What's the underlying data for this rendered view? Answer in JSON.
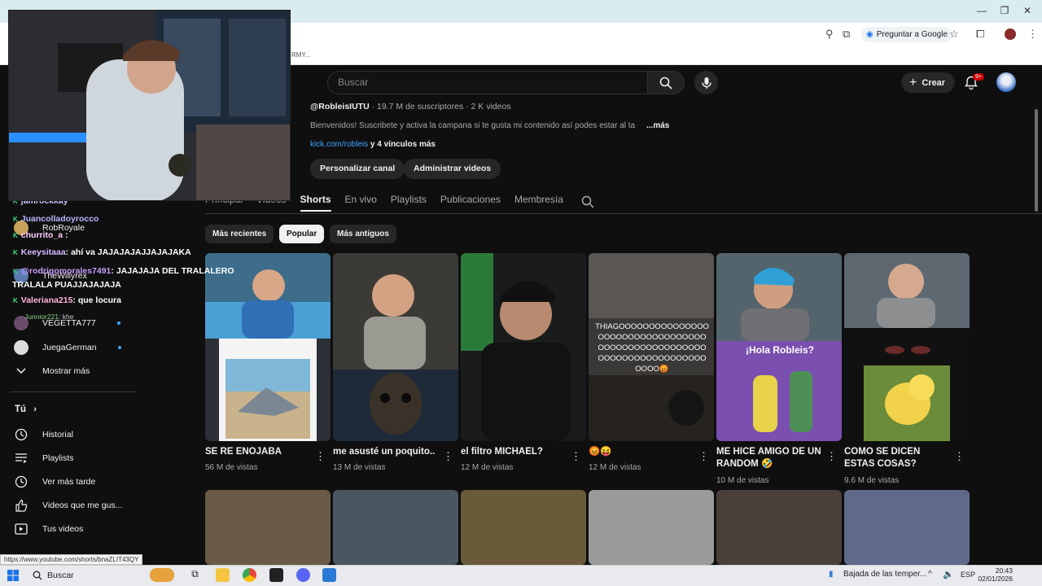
{
  "browser": {
    "ask_google": "Preguntar a Google",
    "bookmark_text": "RMY..."
  },
  "header": {
    "search_placeholder": "Buscar",
    "create_label": "Crear",
    "notification_count": "9+"
  },
  "channel": {
    "handle": "@RobleisIUTU",
    "stats": " · 19.7 M de suscriptores · 2 K videos",
    "description": "Bienvenidos! Suscribete y activa la campana si te gusta mi contenido así podes estar al ta",
    "more": "...más",
    "link": "kick.com/robleis",
    "links_more": " y 4 vínculos más",
    "btn_customize": "Personalizar canal",
    "btn_manage": "Administrar videos"
  },
  "tabs": [
    "Principal",
    "Videos",
    "Shorts",
    "En vivo",
    "Playlists",
    "Publicaciones",
    "Membresía"
  ],
  "chips": [
    "Más recientes",
    "Popular",
    "Más antiguos"
  ],
  "shorts": [
    {
      "title": "SE RE ENOJABA",
      "views": "56 M de vistas"
    },
    {
      "title": "me asusté un poquito..",
      "views": "13 M de vistas"
    },
    {
      "title": "el filtro MICHAEL?",
      "views": "12 M de vistas"
    },
    {
      "title": "😡😝",
      "views": "12 M de vistas"
    },
    {
      "title": "ME HICE AMIGO DE UN RANDOM 🤣",
      "views": "10 M de vistas"
    },
    {
      "title": "COMO SE DICEN ESTAS COSAS?",
      "views": "9.6 M de vistas"
    }
  ],
  "thumb_overlays": {
    "thiago": "THIAGOOOOOOOOOOOOOOOOOOOOOOOOOOOOOOOOOOOOOOOOOOOOOOOOOOOOOOOOOOOOOOOOOOOOOOOOO😡",
    "hola": "¡Hola Robleis?"
  },
  "sidebar": {
    "subs": [
      {
        "label": "RobRoyale"
      },
      {
        "label": "TheWillyrex"
      },
      {
        "label": "VEGETTA777"
      },
      {
        "label": "JuegaGerman"
      }
    ],
    "show_more": "Mostrar más",
    "you_section": "Tú",
    "you_items": [
      "Historial",
      "Playlists",
      "Ver más tarde",
      "Videos que me gus...",
      "Tus videos"
    ]
  },
  "chat": [
    {
      "user": "jamrockkay",
      "msg": ""
    },
    {
      "user": "Juancolladoyrocco",
      "msg": ""
    },
    {
      "user": "churrito_a",
      "msg": ""
    },
    {
      "user": "Keeysitaaa",
      "msg": ": ahí va JAJAJAJAJJAJAJAKA"
    },
    {
      "user": "@rodrigomorales7491",
      "msg": ": JAJAJAJA DEL TRALALERO TRALALA PUAJJAJAJAJA"
    },
    {
      "user": "Valeriana215",
      "msg": ": que locura"
    },
    {
      "user": "Junnior221",
      "msg": ": khe"
    }
  ],
  "status_url": "https://www.youtube.com/shorts/bnaZLIT43QY",
  "taskbar": {
    "search": "Buscar",
    "weather": "Bajada de las temper...",
    "lang": "ESP",
    "time": "20:43",
    "date": "02/01/2026"
  }
}
